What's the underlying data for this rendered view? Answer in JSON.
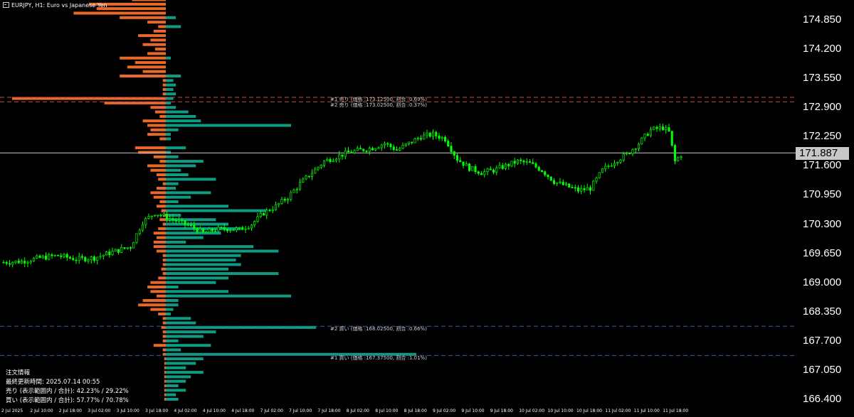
{
  "window": {
    "title": "EURJPY, H1:  Euro vs Japanese Yen"
  },
  "price_axis": {
    "labels": [
      "174.850",
      "174.200",
      "173.550",
      "172.900",
      "172.250",
      "171.600",
      "170.950",
      "170.300",
      "169.650",
      "169.000",
      "168.350",
      "167.700",
      "167.050",
      "166.400"
    ],
    "current_price": "171.887"
  },
  "time_axis": {
    "labels": [
      "2 Jul 2025",
      "2 Jul 10:00",
      "2 Jul 18:00",
      "3 Jul 02:00",
      "3 Jul 10:00",
      "3 Jul 18:00",
      "4 Jul 02:00",
      "4 Jul 10:00",
      "4 Jul 18:00",
      "7 Jul 02:00",
      "7 Jul 10:00",
      "7 Jul 18:00",
      "8 Jul 02:00",
      "8 Jul 10:00",
      "8 Jul 18:00",
      "9 Jul 02:00",
      "9 Jul 10:00",
      "9 Jul 18:00",
      "10 Jul 02:00",
      "10 Jul 10:00",
      "10 Jul 18:00",
      "11 Jul 02:00",
      "11 Jul 10:00",
      "11 Jul 18:00"
    ]
  },
  "orders": {
    "sell1": "#1 売り (価格 :173.12500, 割合 :0.69%)",
    "sell2": "#2 売り (価格 :173.02500, 割合 :0.37%)",
    "buy2": "#2 買い (価格 :168.02500, 割合 :0.66%)",
    "buy1": "#1 買い (価格 :167.37500, 割合 :1.01%)"
  },
  "info_panel": {
    "heading": "注文情報",
    "updated": "最終更新時間: 2025.07.14 00:55",
    "sell": "売り (表示範囲内 / 合計): 42.23% / 29.22%",
    "buy": "買い (表示範囲内 / 合計): 57.77% / 70.78%"
  },
  "colors": {
    "background": "#000000",
    "candle": "#00ff00",
    "sell_bar": "#e8692a",
    "buy_bar": "#0d9b84",
    "sell_line": "#c0504d",
    "buy_line": "#2f5f9f",
    "current_price_line": "#c8c8c8"
  },
  "chart_data": {
    "type": "candlestick",
    "symbol": "EURJPY",
    "timeframe": "H1",
    "current_price": 171.887,
    "ylim": [
      166.3,
      175.4
    ],
    "price_path": [
      [
        0,
        169.45
      ],
      [
        6,
        169.47
      ],
      [
        12,
        169.55
      ],
      [
        18,
        169.6
      ],
      [
        24,
        169.52
      ],
      [
        30,
        169.55
      ],
      [
        36,
        169.68
      ],
      [
        42,
        169.8
      ],
      [
        46,
        170.35
      ],
      [
        50,
        170.55
      ],
      [
        54,
        170.45
      ],
      [
        58,
        170.35
      ],
      [
        62,
        170.25
      ],
      [
        66,
        170.1
      ],
      [
        70,
        170.18
      ],
      [
        74,
        170.2
      ],
      [
        78,
        170.18
      ],
      [
        82,
        170.3
      ],
      [
        86,
        170.55
      ],
      [
        90,
        170.7
      ],
      [
        94,
        170.9
      ],
      [
        98,
        171.2
      ],
      [
        102,
        171.45
      ],
      [
        106,
        171.7
      ],
      [
        110,
        171.8
      ],
      [
        114,
        171.9
      ],
      [
        118,
        171.95
      ],
      [
        122,
        172.0
      ],
      [
        126,
        172.1
      ],
      [
        130,
        171.95
      ],
      [
        134,
        172.1
      ],
      [
        138,
        172.25
      ],
      [
        142,
        172.3
      ],
      [
        146,
        172.2
      ],
      [
        150,
        171.75
      ],
      [
        154,
        171.55
      ],
      [
        158,
        171.45
      ],
      [
        162,
        171.5
      ],
      [
        166,
        171.6
      ],
      [
        170,
        171.7
      ],
      [
        174,
        171.65
      ],
      [
        178,
        171.5
      ],
      [
        182,
        171.25
      ],
      [
        186,
        171.15
      ],
      [
        190,
        171.05
      ],
      [
        194,
        171.1
      ],
      [
        198,
        171.5
      ],
      [
        202,
        171.7
      ],
      [
        206,
        171.85
      ],
      [
        210,
        172.1
      ],
      [
        214,
        172.4
      ],
      [
        218,
        172.45
      ],
      [
        220,
        172.35
      ],
      [
        222,
        171.7
      ],
      [
        224,
        171.85
      ]
    ],
    "order_levels": [
      {
        "side": "sell",
        "index": 1,
        "price": 173.125,
        "ratio": 0.69
      },
      {
        "side": "sell",
        "index": 2,
        "price": 173.025,
        "ratio": 0.37
      },
      {
        "side": "buy",
        "index": 2,
        "price": 168.025,
        "ratio": 0.66
      },
      {
        "side": "buy",
        "index": 1,
        "price": 167.375,
        "ratio": 1.01
      }
    ],
    "order_book_profile": [
      {
        "price": 175.3,
        "sell": 0.22,
        "buy": 0
      },
      {
        "price": 175.2,
        "sell": 0.5,
        "buy": 0
      },
      {
        "price": 175.1,
        "sell": 0.45,
        "buy": 0
      },
      {
        "price": 175.0,
        "sell": 0.6,
        "buy": 0
      },
      {
        "price": 174.9,
        "sell": 0.3,
        "buy": 0.04
      },
      {
        "price": 174.8,
        "sell": 0.12,
        "buy": 0
      },
      {
        "price": 174.7,
        "sell": 0.05,
        "buy": 0.06
      },
      {
        "price": 174.6,
        "sell": 0.08,
        "buy": 0
      },
      {
        "price": 174.5,
        "sell": 0.18,
        "buy": 0
      },
      {
        "price": 174.4,
        "sell": 0.1,
        "buy": 0
      },
      {
        "price": 174.3,
        "sell": 0.15,
        "buy": 0
      },
      {
        "price": 174.2,
        "sell": 0.07,
        "buy": 0
      },
      {
        "price": 174.1,
        "sell": 0.12,
        "buy": 0
      },
      {
        "price": 174.0,
        "sell": 0.3,
        "buy": 0.02
      },
      {
        "price": 173.9,
        "sell": 0.2,
        "buy": 0
      },
      {
        "price": 173.8,
        "sell": 0.25,
        "buy": 0
      },
      {
        "price": 173.7,
        "sell": 0.15,
        "buy": 0
      },
      {
        "price": 173.6,
        "sell": 0.3,
        "buy": 0.06
      },
      {
        "price": 173.5,
        "sell": 0.02,
        "buy": 0.03
      },
      {
        "price": 173.4,
        "sell": 0.02,
        "buy": 0.04
      },
      {
        "price": 173.3,
        "sell": 0.02,
        "buy": 0.03
      },
      {
        "price": 173.2,
        "sell": 0.02,
        "buy": 0.04
      },
      {
        "price": 173.1,
        "sell": 1.0,
        "buy": 0.03
      },
      {
        "price": 173.0,
        "sell": 0.4,
        "buy": 0.02
      },
      {
        "price": 172.9,
        "sell": 0.1,
        "buy": 0.04
      },
      {
        "price": 172.8,
        "sell": 0.07,
        "buy": 0.09
      },
      {
        "price": 172.7,
        "sell": 0.04,
        "buy": 0.12
      },
      {
        "price": 172.6,
        "sell": 0.15,
        "buy": 0.14
      },
      {
        "price": 172.5,
        "sell": 0.12,
        "buy": 0.5
      },
      {
        "price": 172.4,
        "sell": 0.1,
        "buy": 0.05
      },
      {
        "price": 172.3,
        "sell": 0.12,
        "buy": 0.02
      },
      {
        "price": 172.2,
        "sell": 0.04,
        "buy": 0.02
      },
      {
        "price": 172.0,
        "sell": 0.2,
        "buy": 0.08
      },
      {
        "price": 171.9,
        "sell": 0.18,
        "buy": 0.02
      },
      {
        "price": 171.8,
        "sell": 0.08,
        "buy": 0.05
      },
      {
        "price": 171.7,
        "sell": 0.04,
        "buy": 0.15
      },
      {
        "price": 171.6,
        "sell": 0.12,
        "buy": 0.12
      },
      {
        "price": 171.5,
        "sell": 0.1,
        "buy": 0.06
      },
      {
        "price": 171.4,
        "sell": 0.06,
        "buy": 0.09
      },
      {
        "price": 171.3,
        "sell": 0.05,
        "buy": 0.2
      },
      {
        "price": 171.2,
        "sell": 0.02,
        "buy": 0.05
      },
      {
        "price": 171.1,
        "sell": 0.06,
        "buy": 0.04
      },
      {
        "price": 171.0,
        "sell": 0.1,
        "buy": 0.18
      },
      {
        "price": 170.9,
        "sell": 0.08,
        "buy": 0.1
      },
      {
        "price": 170.8,
        "sell": 0.04,
        "buy": 0.05
      },
      {
        "price": 170.7,
        "sell": 0.06,
        "buy": 0.25
      },
      {
        "price": 170.6,
        "sell": 0.03,
        "buy": 0.4
      },
      {
        "price": 170.5,
        "sell": 0.02,
        "buy": 0.06
      },
      {
        "price": 170.4,
        "sell": 0.04,
        "buy": 0.2
      },
      {
        "price": 170.3,
        "sell": 0.02,
        "buy": 0.25
      },
      {
        "price": 170.2,
        "sell": 0.05,
        "buy": 0.3
      },
      {
        "price": 170.1,
        "sell": 0.08,
        "buy": 0.22
      },
      {
        "price": 170.0,
        "sell": 0.06,
        "buy": 0.15
      },
      {
        "price": 169.9,
        "sell": 0.08,
        "buy": 0.08
      },
      {
        "price": 169.8,
        "sell": 0.08,
        "buy": 0.35
      },
      {
        "price": 169.7,
        "sell": 0.06,
        "buy": 0.45
      },
      {
        "price": 169.6,
        "sell": 0.02,
        "buy": 0.3
      },
      {
        "price": 169.5,
        "sell": 0.02,
        "buy": 0.28
      },
      {
        "price": 169.4,
        "sell": 0.02,
        "buy": 0.3
      },
      {
        "price": 169.3,
        "sell": 0.03,
        "buy": 0.25
      },
      {
        "price": 169.2,
        "sell": 0.02,
        "buy": 0.45
      },
      {
        "price": 169.1,
        "sell": 0.05,
        "buy": 0.25
      },
      {
        "price": 169.0,
        "sell": 0.1,
        "buy": 0.2
      },
      {
        "price": 168.9,
        "sell": 0.12,
        "buy": 0.05
      },
      {
        "price": 168.8,
        "sell": 0.1,
        "buy": 0.25
      },
      {
        "price": 168.7,
        "sell": 0.06,
        "buy": 0.5
      },
      {
        "price": 168.6,
        "sell": 0.15,
        "buy": 0.05
      },
      {
        "price": 168.5,
        "sell": 0.18,
        "buy": 0.05
      },
      {
        "price": 168.4,
        "sell": 0.1,
        "buy": 0.03
      },
      {
        "price": 168.3,
        "sell": 0.05,
        "buy": 0.02
      },
      {
        "price": 168.2,
        "sell": 0.02,
        "buy": 0.1
      },
      {
        "price": 168.1,
        "sell": 0.02,
        "buy": 0.12
      },
      {
        "price": 168.0,
        "sell": 0.03,
        "buy": 0.6
      },
      {
        "price": 167.9,
        "sell": 0.02,
        "buy": 0.2
      },
      {
        "price": 167.8,
        "sell": 0.02,
        "buy": 0.15
      },
      {
        "price": 167.7,
        "sell": 0.02,
        "buy": 0.05
      },
      {
        "price": 167.6,
        "sell": 0.08,
        "buy": 0.18
      },
      {
        "price": 167.5,
        "sell": 0.02,
        "buy": 0.06
      },
      {
        "price": 167.4,
        "sell": 0.02,
        "buy": 1.0
      },
      {
        "price": 167.3,
        "sell": 0.01,
        "buy": 0.15
      },
      {
        "price": 167.2,
        "sell": 0.01,
        "buy": 0.12
      },
      {
        "price": 167.1,
        "sell": 0.01,
        "buy": 0.08
      },
      {
        "price": 167.0,
        "sell": 0.01,
        "buy": 0.15
      },
      {
        "price": 166.9,
        "sell": 0.01,
        "buy": 0.1
      },
      {
        "price": 166.8,
        "sell": 0.01,
        "buy": 0.08
      },
      {
        "price": 166.7,
        "sell": 0.01,
        "buy": 0.05
      },
      {
        "price": 166.6,
        "sell": 0.01,
        "buy": 0.08
      },
      {
        "price": 166.5,
        "sell": 0.01,
        "buy": 0.04
      },
      {
        "price": 166.4,
        "sell": 0.01,
        "buy": 0.05
      }
    ]
  }
}
